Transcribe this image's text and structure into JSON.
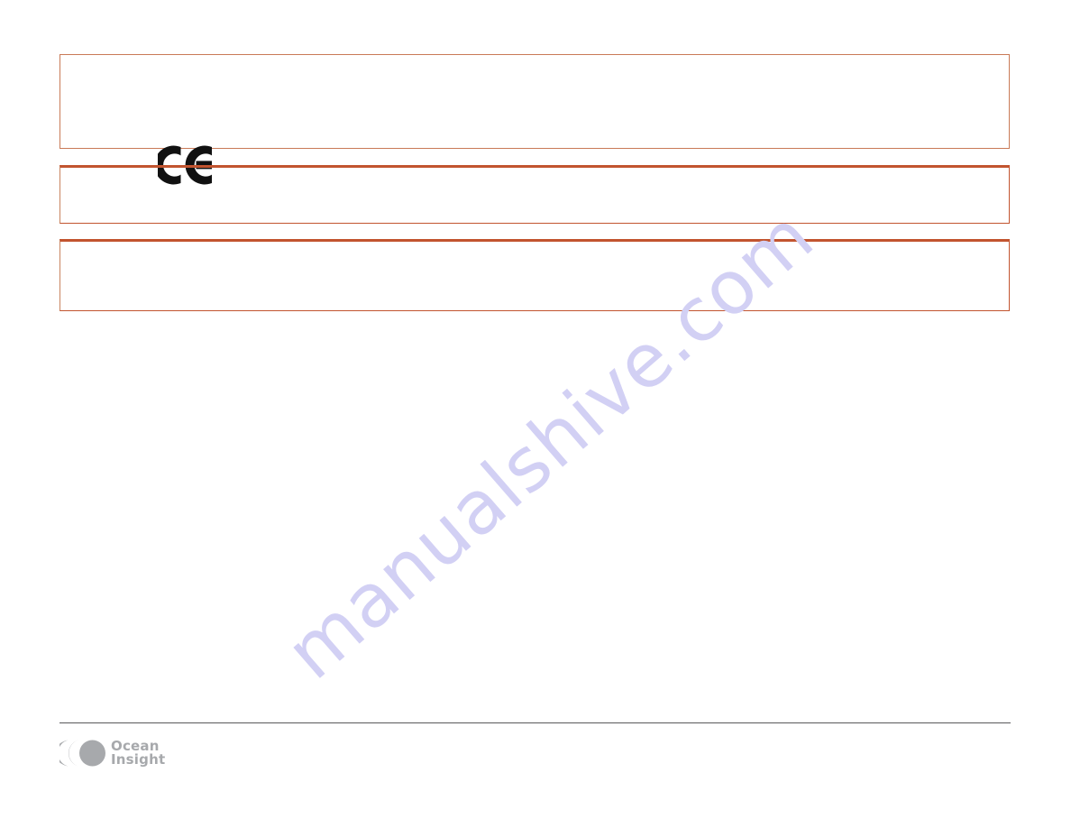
{
  "document": {
    "page_background": "#ffffff",
    "accent_color": "#c2542f",
    "watermark_color": "#d2d0f4",
    "footer_rule_color": "#58585a",
    "logo_color": "#a7a9ac"
  },
  "watermark": {
    "text": "manualshive.com"
  },
  "notices": [
    {
      "id": "ce-declaration",
      "icon": "ce-mark-icon",
      "icon_label": "CE",
      "body": ""
    },
    {
      "id": "notice-two",
      "body": ""
    },
    {
      "id": "notice-three",
      "body": ""
    }
  ],
  "footer": {
    "logo_name": "ocean-insight-logo",
    "logo_line1": "Ocean",
    "logo_line2": "Insight"
  }
}
